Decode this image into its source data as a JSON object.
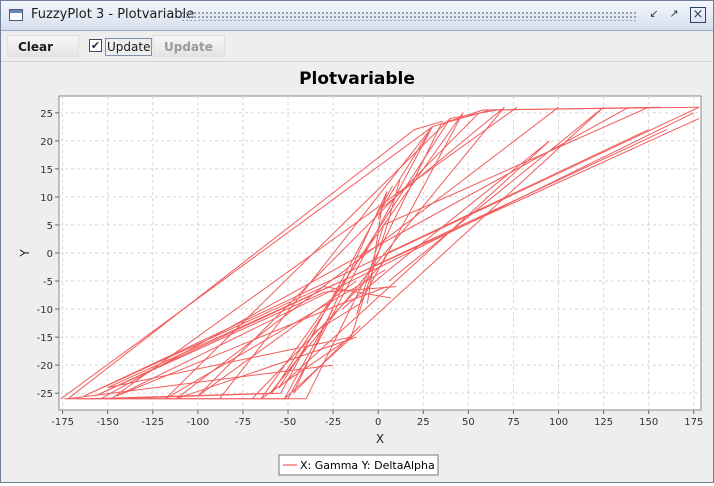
{
  "window": {
    "title": "FuzzyPlot 3 - Plotvariable",
    "controls": {
      "minimize_icon": "minimize-icon",
      "maximize_icon": "maximize-icon",
      "close_icon": "close-icon"
    }
  },
  "toolbar": {
    "clear_label": "Clear",
    "update_checkbox_label": "Update",
    "update_checkbox_checked": true,
    "update_button_label": "Update"
  },
  "chart_data": {
    "type": "line",
    "title": "Plotvariable",
    "xlabel": "X",
    "ylabel": "Y",
    "xlim": [
      -177,
      179
    ],
    "ylim": [
      -28,
      28
    ],
    "x_ticks": [
      -175,
      -150,
      -125,
      -100,
      -75,
      -50,
      -25,
      0,
      25,
      50,
      75,
      100,
      125,
      150,
      175
    ],
    "y_ticks": [
      -25,
      -20,
      -15,
      -10,
      -5,
      0,
      5,
      10,
      15,
      20,
      25
    ],
    "x_tick_labels": [
      "-175",
      "-150",
      "-125",
      "-100",
      "-75",
      "-50",
      "-25",
      "0",
      "25",
      "50",
      "75",
      "100",
      "125",
      "150",
      "175"
    ],
    "y_tick_labels": [
      "-25",
      "-20",
      "-15",
      "-10",
      "-5",
      "0",
      "5",
      "10",
      "15",
      "20",
      "25"
    ],
    "grid": true,
    "legend_position": "bottom-center",
    "series": [
      {
        "name": "X: Gamma Y: DeltaAlpha",
        "color": "#f25c5c",
        "points": [
          [
            -174,
            -26
          ],
          [
            -50,
            -26
          ],
          [
            30,
            22.5
          ],
          [
            58,
            25.5
          ],
          [
            178,
            26
          ],
          [
            -167,
            -26
          ],
          [
            -40,
            -26
          ],
          [
            35,
            23
          ],
          [
            62,
            25.5
          ],
          [
            157,
            26
          ],
          [
            -160,
            -26
          ],
          [
            -59,
            -25
          ],
          [
            40,
            24
          ],
          [
            66,
            25.5
          ],
          [
            139,
            26
          ],
          [
            -154,
            -26
          ],
          [
            -25,
            -20
          ],
          [
            -172,
            -26
          ],
          [
            20,
            22
          ],
          [
            36,
            23.5
          ],
          [
            77,
            26
          ],
          [
            -148,
            -26
          ],
          [
            -54,
            -25
          ],
          [
            8,
            12
          ],
          [
            30,
            22.5
          ],
          [
            -176,
            -26
          ],
          [
            178,
            26
          ],
          [
            -163,
            -25.5
          ],
          [
            -30,
            -6
          ],
          [
            7,
            -8
          ],
          [
            160,
            22
          ],
          [
            -157,
            -25.5
          ],
          [
            -30,
            -7
          ],
          [
            10,
            -6
          ],
          [
            175,
            25
          ],
          [
            -145,
            -25.5
          ],
          [
            -20,
            -9
          ],
          [
            5,
            -6
          ],
          [
            178,
            24
          ],
          [
            -150,
            -24
          ],
          [
            -15,
            -15
          ],
          [
            5,
            5
          ],
          [
            12,
            13
          ],
          [
            40,
            24
          ],
          [
            -118,
            -26
          ],
          [
            4,
            -3
          ],
          [
            56,
            25
          ],
          [
            -100,
            -25.5
          ],
          [
            -12,
            -5
          ],
          [
            100,
            26
          ],
          [
            -112,
            -26
          ],
          [
            -12,
            -15
          ],
          [
            6,
            -5
          ],
          [
            125,
            26
          ],
          [
            -52,
            -26
          ],
          [
            -25,
            -10
          ],
          [
            0,
            6
          ],
          [
            5,
            11
          ],
          [
            -47,
            -25
          ],
          [
            -10,
            -13
          ],
          [
            2,
            8
          ],
          [
            30,
            22.5
          ],
          [
            -88,
            -26
          ],
          [
            -12,
            -11
          ],
          [
            3,
            5
          ],
          [
            150,
            26
          ],
          [
            -70,
            -26
          ],
          [
            2,
            -2
          ],
          [
            47,
            25
          ],
          [
            -65,
            -26
          ],
          [
            -15,
            -15
          ],
          [
            -6,
            -9
          ],
          [
            2,
            8
          ],
          [
            70,
            26
          ],
          [
            -60,
            -25
          ],
          [
            -40,
            -17
          ],
          [
            -20,
            -10
          ],
          [
            6,
            -3
          ],
          [
            95,
            20
          ],
          [
            -55,
            -24
          ],
          [
            -35,
            -14
          ],
          [
            -10,
            -9
          ],
          [
            5,
            0
          ],
          [
            150,
            22
          ]
        ],
        "breaks": [
          5,
          10,
          14,
          16,
          20,
          24,
          26,
          30,
          34,
          38,
          43,
          46,
          49,
          52,
          56,
          60,
          63,
          66,
          71,
          76
        ]
      }
    ]
  }
}
